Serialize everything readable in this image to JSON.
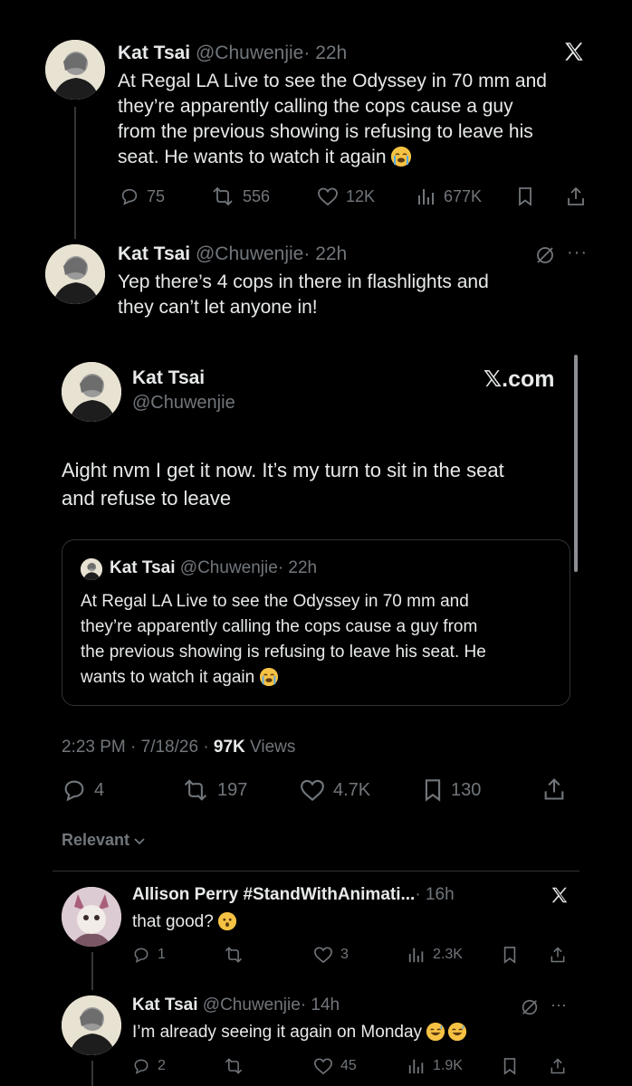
{
  "tweet1": {
    "name": "Kat Tsai",
    "handle": "@Chuwenjie",
    "time": "· 22h",
    "text": "At Regal LA Live to see the Odyssey in 70 mm and they’re apparently calling the cops cause a guy from the previous showing is refusing to leave his seat. He wants to watch it again",
    "line1": "At Regal LA Live to see the Odyssey in 70 mm and",
    "line2": "they’re apparently calling the cops cause a guy",
    "line3": "from the previous showing is refusing to leave his",
    "line4": "seat. He wants to watch it again",
    "replies": "75",
    "reposts": "556",
    "likes": "12K",
    "views": "677K"
  },
  "tweet2": {
    "name": "Kat Tsai",
    "handle": "@Chuwenjie",
    "time": "· 22h",
    "line1": "Yep there’s 4 cops in there in flashlights and",
    "line2": "they can’t let anyone in!"
  },
  "main_post": {
    "name": "Kat Tsai",
    "handle": "@Chuwenjie",
    "brand": "𝕏.com",
    "line1": "Aight nvm I get it now. It’s my turn to sit in the seat",
    "line2": "and refuse to leave",
    "quote": {
      "name": "Kat Tsai",
      "handle": "@Chuwenjie",
      "time": "· 22h",
      "line1": "At Regal LA Live to see the Odyssey in 70 mm and",
      "line2": "they’re apparently calling the cops cause a guy from",
      "line3": "the previous showing is refusing to leave his seat. He",
      "line4": "wants to watch it again"
    },
    "timestamp": "2:23 PM · 7/18/26 · ",
    "views_count": "97K",
    "views_label": " Views",
    "replies": "4",
    "reposts": "197",
    "likes": "4.7K",
    "bookmarks": "130"
  },
  "sort_label": "Relevant",
  "reply1": {
    "name": "Allison Perry #StandWithAnimati...",
    "time": "· 16h",
    "text": "that good?",
    "replies": "1",
    "likes": "3",
    "views": "2.3K"
  },
  "reply2": {
    "name": "Kat Tsai",
    "handle": "@Chuwenjie",
    "time": "· 14h",
    "text": "I’m already seeing it again on Monday",
    "replies": "2",
    "likes": "45",
    "views": "1.9K"
  },
  "colors": {
    "background": "#000000",
    "text": "#e7e9ea",
    "muted": "#71767b",
    "emoji": "#f6c244"
  }
}
